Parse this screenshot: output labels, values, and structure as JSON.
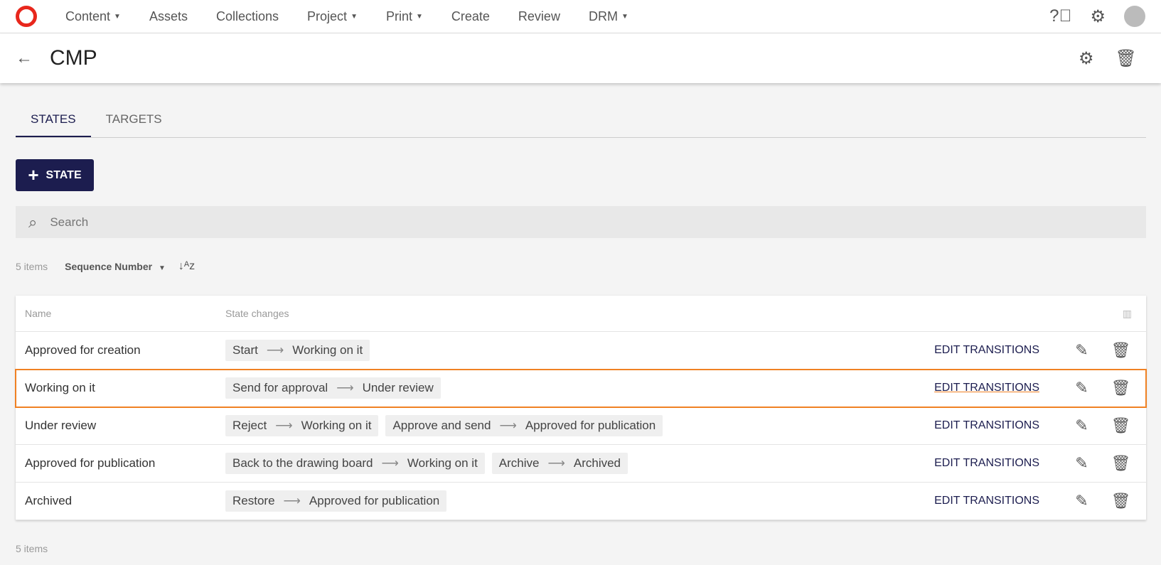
{
  "nav": {
    "items": [
      {
        "label": "Content",
        "dropdown": true
      },
      {
        "label": "Assets"
      },
      {
        "label": "Collections"
      },
      {
        "label": "Project",
        "dropdown": true
      },
      {
        "label": "Print",
        "dropdown": true
      },
      {
        "label": "Create"
      },
      {
        "label": "Review"
      },
      {
        "label": "DRM",
        "dropdown": true
      }
    ]
  },
  "header": {
    "title": "CMP"
  },
  "tabs": [
    "STATES",
    "TARGETS"
  ],
  "add_button": "STATE",
  "search": {
    "placeholder": "Search"
  },
  "meta": {
    "count": "5 items",
    "sort": "Sequence Number"
  },
  "table": {
    "headers": [
      "Name",
      "State changes"
    ],
    "edit_label": "EDIT TRANSITIONS",
    "rows": [
      {
        "name": "Approved for creation",
        "changes": [
          {
            "action": "Start",
            "target": "Working on it"
          }
        ]
      },
      {
        "name": "Working on it",
        "changes": [
          {
            "action": "Send for approval",
            "target": "Under review"
          }
        ]
      },
      {
        "name": "Under review",
        "changes": [
          {
            "action": "Reject",
            "target": "Working on it"
          },
          {
            "action": "Approve and send",
            "target": "Approved for publication"
          }
        ]
      },
      {
        "name": "Approved for publication",
        "changes": [
          {
            "action": "Back to the drawing board",
            "target": "Working on it"
          },
          {
            "action": "Archive",
            "target": "Archived"
          }
        ]
      },
      {
        "name": "Archived",
        "changes": [
          {
            "action": "Restore",
            "target": "Approved for publication"
          }
        ]
      }
    ]
  },
  "footer": {
    "count": "5 items"
  },
  "colors": {
    "primary": "#1c1d4f",
    "highlight": "#f08123",
    "logo": "#e8271c"
  }
}
